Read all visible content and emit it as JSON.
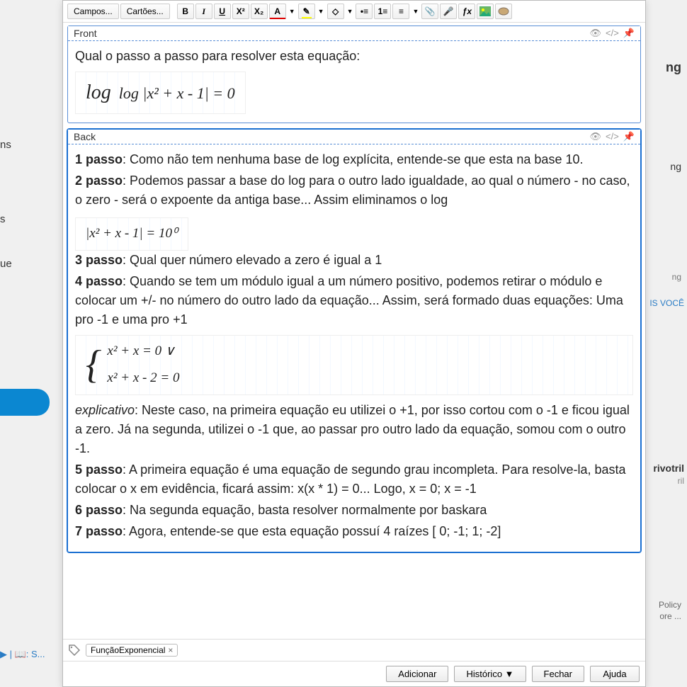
{
  "toolbar": {
    "fields_btn": "Campos...",
    "cards_btn": "Cartões...",
    "bold": "B",
    "italic": "I",
    "underline": "U",
    "sup": "X²",
    "sub": "X₂",
    "textcolor": "A",
    "highlight": "✎",
    "eraser": "◇",
    "ul": "•≡",
    "ol": "1≡",
    "align": "≡",
    "attach": "📎",
    "mic": "🎤",
    "fx": "ƒx"
  },
  "fields": {
    "front": {
      "label": "Front",
      "text": "Qual o passo a passo para resolver esta equação:",
      "eq": "log |x² + x - 1| = 0"
    },
    "back": {
      "label": "Back",
      "p1_b": "1 passo",
      "p1": ": Como não tem nenhuma base de log explícita, entende-se que esta na base 10.",
      "p2_b": "2 passo",
      "p2": ": Podemos passar a base do log para o outro lado igualdade, ao qual o número - no caso, o zero - será o expoente da antiga base... Assim eliminamos o log",
      "eq2": "|x² + x - 1|  =  10⁰",
      "p3_b": "3 passo",
      "p3": ": Qual quer número elevado a zero é igual a 1",
      "p4_b": "4 passo",
      "p4": ":  Quando se tem um módulo igual a um número positivo, podemos retirar o módulo e colocar um +/- no número do outro lado da equação... Assim, será formado duas equações: Uma pro -1 e uma pro +1",
      "eq3a": "x² + x  =  0        ∨",
      "eq3b": "x² + x - 2 = 0",
      "exp_b": "explicativo",
      "exp": ": Neste caso, na primeira equação eu utilizei o +1, por isso cortou com o -1 e ficou igual a zero. Já na segunda, utilizei o -1 que, ao passar pro outro lado da equação, somou com o outro -1.",
      "p5_b": "5 passo",
      "p5": ": A primeira equação é uma equação de segundo grau incompleta. Para resolve-la, basta colocar o x em evidência, ficará assim: x(x * 1) = 0... Logo, x = 0; x = -1",
      "p6_b": "6 passo",
      "p6": ": Na segunda equação, basta resolver normalmente por baskara",
      "p7_b": "7 passo",
      "p7": ": Agora, entende-se que esta equação possuí 4 raízes [ 0; -1; 1; -2]"
    }
  },
  "tag": {
    "name": "FunçãoExponencial",
    "close": "×"
  },
  "buttons": {
    "add": "Adicionar",
    "history": "Histórico ▼",
    "close": "Fechar",
    "help": "Ajuda"
  },
  "bg": {
    "frag1": "ns",
    "frag2": "s",
    "frag3": "ue",
    "frag_ng": "ng",
    "frag_ng2": "ng",
    "frag_ng3": "ng",
    "frag_voc": "IS VOCÊ",
    "frag_riv": "rivotril",
    "frag_ril": "ril",
    "frag_policy": "Policy",
    "frag_ore": "ore ...",
    "frag_side": "▶ | 📖: S..."
  }
}
